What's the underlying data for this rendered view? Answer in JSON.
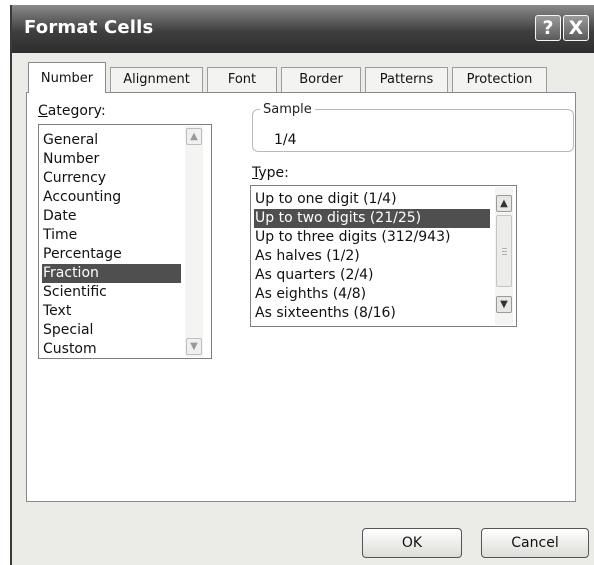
{
  "window": {
    "title": "Format Cells"
  },
  "titlebar_buttons": {
    "help_glyph": "?",
    "close_glyph": "X"
  },
  "tabs": [
    {
      "label": "Number",
      "active": true
    },
    {
      "label": "Alignment",
      "active": false
    },
    {
      "label": "Font",
      "active": false
    },
    {
      "label": "Border",
      "active": false
    },
    {
      "label": "Patterns",
      "active": false
    },
    {
      "label": "Protection",
      "active": false
    }
  ],
  "category": {
    "label_accel": "C",
    "label_rest": "ategory:",
    "items": [
      "General",
      "Number",
      "Currency",
      "Accounting",
      "Date",
      "Time",
      "Percentage",
      "Fraction",
      "Scientific",
      "Text",
      "Special",
      "Custom"
    ],
    "selected": "Fraction"
  },
  "sample": {
    "legend": "Sample",
    "value": "1/4"
  },
  "type": {
    "label_accel": "T",
    "label_rest": "ype:",
    "items": [
      "Up to one digit (1/4)",
      "Up to two digits (21/25)",
      "Up to three digits (312/943)",
      "As halves (1/2)",
      "As quarters (2/4)",
      "As eighths (4/8)",
      "As sixteenths (8/16)"
    ],
    "selected": "Up to two digits (21/25)"
  },
  "buttons": {
    "ok": "OK",
    "cancel": "Cancel"
  },
  "colors": {
    "selection": "#4f4f4f",
    "titlebar": "#3f3f3f",
    "dialog_bg": "#ebebe8"
  }
}
